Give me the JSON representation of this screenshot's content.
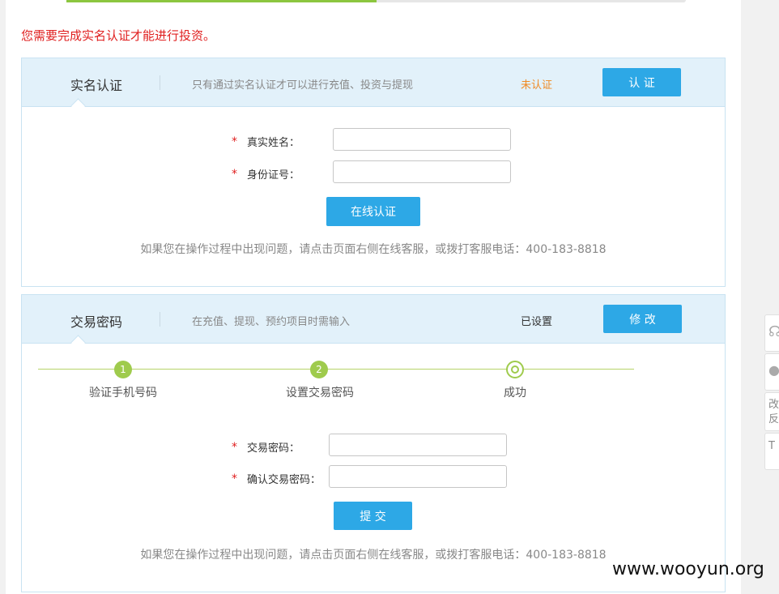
{
  "progress": {
    "percent": 50
  },
  "notice": "您需要完成实名认证才能进行投资。",
  "realname": {
    "title": "实名认证",
    "desc": "只有通过实名认证才可以进行充值、投资与提现",
    "status": "未认证",
    "status_color": "#f08a24",
    "button": "认 证",
    "fields": [
      {
        "label": "真实姓名：",
        "value": ""
      },
      {
        "label": "身份证号：",
        "value": ""
      }
    ],
    "submit": "在线认证",
    "help": "如果您在操作过程中出现问题，请点击页面右侧在线客服，或拨打客服电话：400-183-8818"
  },
  "trade_password": {
    "title": "交易密码",
    "desc": "在充值、提现、预约项目时需输入",
    "status": "已设置",
    "status_color": "#333333",
    "button": "修 改",
    "steps": [
      {
        "num": "1",
        "label": "验证手机号码"
      },
      {
        "num": "2",
        "label": "设置交易密码"
      },
      {
        "num": "",
        "label": "成功"
      }
    ],
    "fields": [
      {
        "label": "交易密码：",
        "value": ""
      },
      {
        "label": "确认交易密码：",
        "value": ""
      }
    ],
    "submit": "提 交",
    "help": "如果您在操作过程中出现问题，请点击页面右侧在线客服，或拨打客服电话：400-183-8818"
  },
  "required_mark": "*",
  "side_widgets": [
    {
      "icon": "headset-icon"
    },
    {
      "icon": "chat-bubble-icon"
    },
    {
      "text": "改\n反"
    },
    {
      "text": "T"
    }
  ],
  "watermark": "www.wooyun.org",
  "colors": {
    "accent": "#2da8e6",
    "step_green": "#9fcb4d",
    "error_red": "#e02020"
  }
}
